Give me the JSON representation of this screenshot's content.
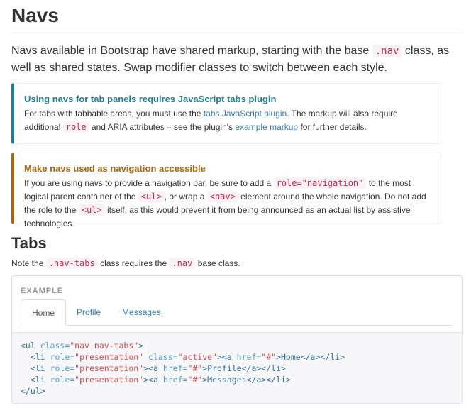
{
  "title": "Navs",
  "lead": {
    "text_before": "Navs available in Bootstrap have shared markup, starting with the base ",
    "code": ".nav",
    "text_after": " class, as well as shared states. Swap modifier classes to switch between each style."
  },
  "callout_info": {
    "heading": "Using navs for tab panels requires JavaScript tabs plugin",
    "p1": "For tabs with tabbable areas, you must use the ",
    "link1": "tabs JavaScript plugin",
    "p2": ". The markup will also require additional ",
    "code1": "role",
    "p3": " and ARIA attributes – see the plugin's ",
    "link2": "example markup",
    "p4": " for further details."
  },
  "callout_warning": {
    "heading": "Make navs used as navigation accessible",
    "p1": "If you are using navs to provide a navigation bar, be sure to add a ",
    "code1": "role=\"navigation\"",
    "p2": " to the most logical parent container of the ",
    "code2": "<ul>",
    "p3": ", or wrap a ",
    "code3": "<nav>",
    "p4": " element around the whole navigation. Do not add the role to the ",
    "code4": "<ul>",
    "p5": " itself, as this would prevent it from being announced as an actual list by assistive technologies."
  },
  "tabs_section": {
    "heading": "Tabs",
    "note_before": "Note the ",
    "note_code1": ".nav-tabs",
    "note_mid": " class requires the ",
    "note_code2": ".nav",
    "note_after": " base class."
  },
  "example": {
    "label": "EXAMPLE",
    "tabs": [
      {
        "label": "Home",
        "active": true
      },
      {
        "label": "Profile",
        "active": false
      },
      {
        "label": "Messages",
        "active": false
      }
    ]
  },
  "code_lines": {
    "l1_a": "<ul ",
    "l1_b": "class=",
    "l1_c": "\"nav nav-tabs\"",
    "l1_d": ">",
    "l2_a": "  <li ",
    "l2_b": "role=",
    "l2_c": "\"presentation\"",
    "l2_d": " class=",
    "l2_e": "\"active\"",
    "l2_f": "><a ",
    "l2_g": "href=",
    "l2_h": "\"#\"",
    "l2_i": ">Home</a></li>",
    "l3_a": "  <li ",
    "l3_b": "role=",
    "l3_c": "\"presentation\"",
    "l3_d": "><a ",
    "l3_e": "href=",
    "l3_f": "\"#\"",
    "l3_g": ">Profile</a></li>",
    "l4_a": "  <li ",
    "l4_b": "role=",
    "l4_c": "\"presentation\"",
    "l4_d": "><a ",
    "l4_e": "href=",
    "l4_f": "\"#\"",
    "l4_g": ">Messages</a></li>",
    "l5_a": "</ul>"
  }
}
